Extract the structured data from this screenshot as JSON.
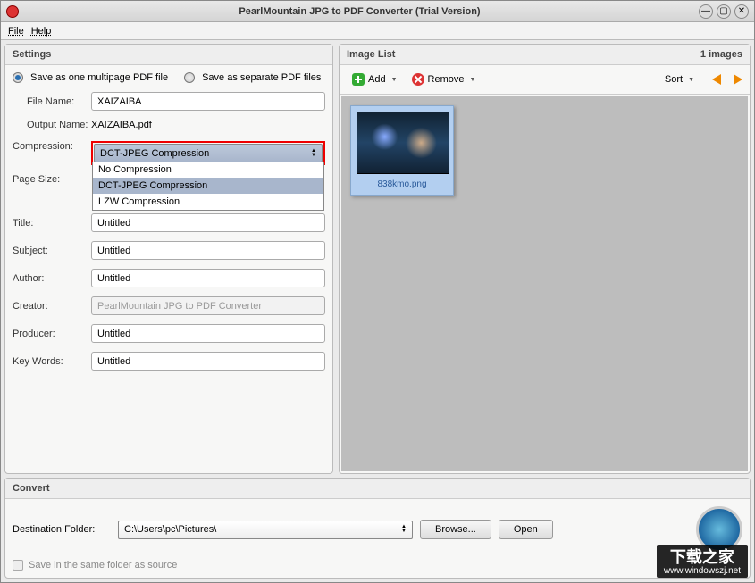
{
  "window": {
    "title": "PearlMountain JPG to PDF Converter (Trial Version)"
  },
  "menu": {
    "file": "File",
    "help": "Help"
  },
  "settings": {
    "title": "Settings",
    "radio_multi": "Save as one multipage PDF file",
    "radio_sep": "Save as separate PDF files",
    "file_name_label": "File Name:",
    "file_name": "XAIZAIBA",
    "output_name_label": "Output Name:",
    "output_name": "XAIZAIBA.pdf",
    "compression_label": "Compression:",
    "compression_selected": "DCT-JPEG Compression",
    "compression_options": [
      "No Compression",
      "DCT-JPEG Compression",
      "LZW Compression"
    ],
    "page_size_label": "Page Size:",
    "title_label": "Title:",
    "title_v": "Untitled",
    "subject_label": "Subject:",
    "subject_v": "Untitled",
    "author_label": "Author:",
    "author_v": "Untitled",
    "creator_label": "Creator:",
    "creator_v": "PearlMountain JPG to PDF Converter",
    "producer_label": "Producer:",
    "producer_v": "Untitled",
    "keywords_label": "Key Words:",
    "keywords_v": "Untitled"
  },
  "imagelist": {
    "title": "Image List",
    "count": "1 images",
    "add": "Add",
    "remove": "Remove",
    "sort": "Sort",
    "items": [
      {
        "name": "838kmo.png"
      }
    ]
  },
  "convert": {
    "title": "Convert",
    "dest_label": "Destination Folder:",
    "dest": "C:\\Users\\pc\\Pictures\\",
    "browse": "Browse...",
    "open": "Open",
    "same_folder": "Save in the same folder as source"
  },
  "watermark": {
    "cn": "下载之家",
    "url": "www.windowszj.net"
  }
}
